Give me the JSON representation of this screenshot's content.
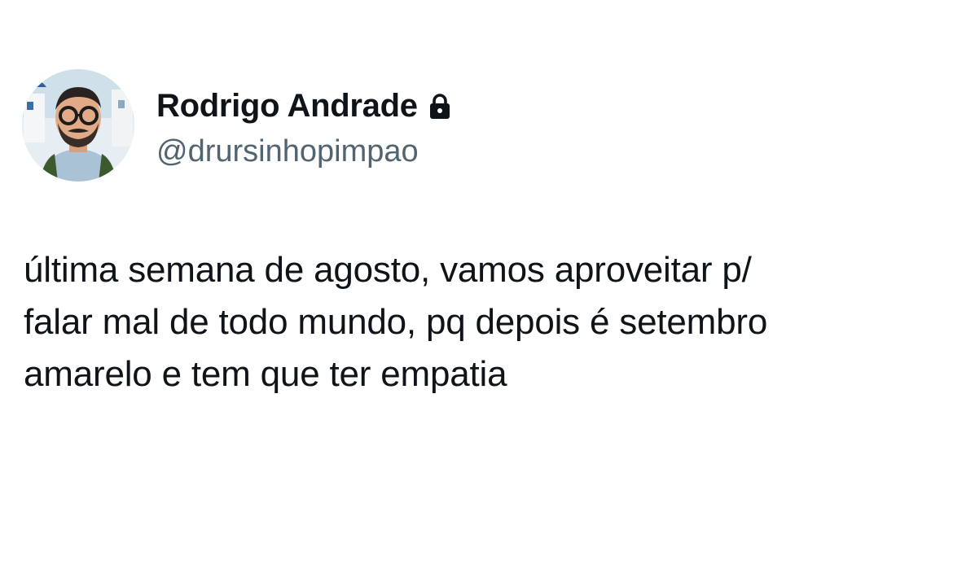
{
  "author": {
    "display_name": "Rodrigo Andrade",
    "handle": "@drursinhopimpao",
    "protected_icon": "lock-icon",
    "avatar": "profile-photo"
  },
  "tweet": {
    "lines": [
      "última semana de agosto, vamos aproveitar p/",
      "falar mal de todo mundo, pq depois é setembro",
      "amarelo e tem que ter empatia"
    ]
  },
  "colors": {
    "background": "#ffffff",
    "text": "#0f1419",
    "secondary_text": "#536471"
  }
}
